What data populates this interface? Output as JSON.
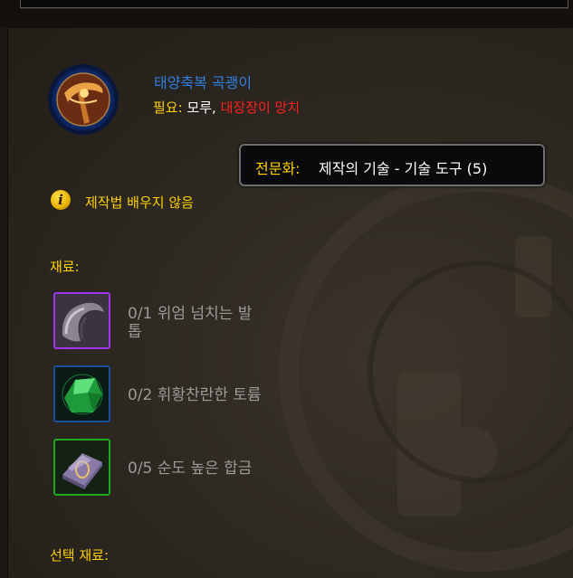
{
  "recipe": {
    "title": "태양축복 곡괭이",
    "requires_label": "필요:",
    "requires_tool_1": "모루,",
    "requires_tool_2": "대장장이 망치"
  },
  "tooltip": {
    "label": "전문화:",
    "value": "제작의 기술 - 기술 도구 (5)"
  },
  "status": {
    "icon": "info-icon",
    "glyph": "i",
    "text": "제작법 배우지 않음"
  },
  "reagents": {
    "label": "재료:",
    "items": [
      {
        "text": "0/1 위엄 넘치는 발톱",
        "line1": "0/1 위엄 넘치는 발",
        "line2": "톱",
        "icon": "claw-icon",
        "rarity_color": "#a335ee",
        "have": 0,
        "need": 1
      },
      {
        "text": "0/2 휘황찬란한 토륨",
        "icon": "green-ore-icon",
        "rarity_color": "#0070dd",
        "have": 0,
        "need": 2
      },
      {
        "text": "0/5 순도 높은 합금",
        "icon": "alloy-ingot-icon",
        "rarity_color": "#1eff00",
        "have": 0,
        "need": 5
      }
    ]
  },
  "optional_reagents": {
    "label": "선택 재료:"
  },
  "colors": {
    "gold": "#ffd100",
    "title_blue": "#2f7fe0",
    "missing_red": "#ff2020",
    "muted_text": "#9a9a9a"
  }
}
